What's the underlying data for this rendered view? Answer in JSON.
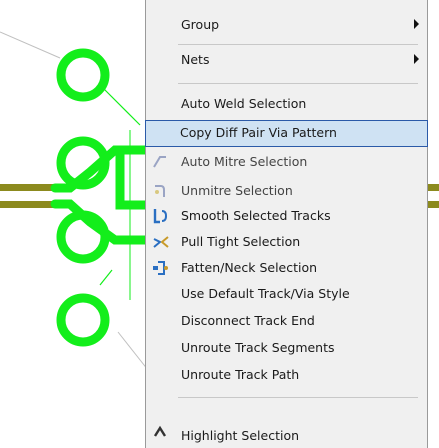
{
  "context_menu": {
    "items": [
      {
        "label": "Group",
        "submenu": true,
        "icon": ""
      },
      {
        "label": "Nets",
        "submenu": true,
        "icon": ""
      },
      {
        "label": "Auto Weld Selection",
        "submenu": false,
        "icon": ""
      },
      {
        "label": "Copy Diff Pair Via Pattern",
        "submenu": false,
        "icon": "",
        "highlighted": true
      },
      {
        "label": "Auto Mitre Selection",
        "submenu": false,
        "icon": "mitre-icon",
        "dimmed": true
      },
      {
        "label": "Unmitre Selection",
        "submenu": false,
        "icon": "unmitre-icon",
        "dimmed": true
      },
      {
        "label": "Smooth Selected Tracks",
        "submenu": false,
        "icon": "smooth-icon"
      },
      {
        "label": "Pull Tight Selection",
        "submenu": false,
        "icon": "pull-tight-icon"
      },
      {
        "label": "Fatten/Neck Selection",
        "submenu": false,
        "icon": "fatten-neck-icon"
      },
      {
        "label": "Use Default Track/Via Style",
        "submenu": false,
        "icon": ""
      },
      {
        "label": "Disconnect Track End",
        "submenu": false,
        "icon": ""
      },
      {
        "label": "Unroute Track Segments",
        "submenu": false,
        "icon": ""
      },
      {
        "label": "Unroute Track Path",
        "submenu": false,
        "icon": ""
      },
      {
        "label": "Highlight Selection",
        "submenu": false,
        "icon": "highlight-icon",
        "partial": true
      }
    ]
  },
  "colors": {
    "pcb_pad": "#13ee1b",
    "pcb_trace": "#8c8a1e",
    "menu_bg": "#f0f0f0",
    "highlight_bg": "#cfe2f3",
    "highlight_border": "#2b5aa8"
  }
}
